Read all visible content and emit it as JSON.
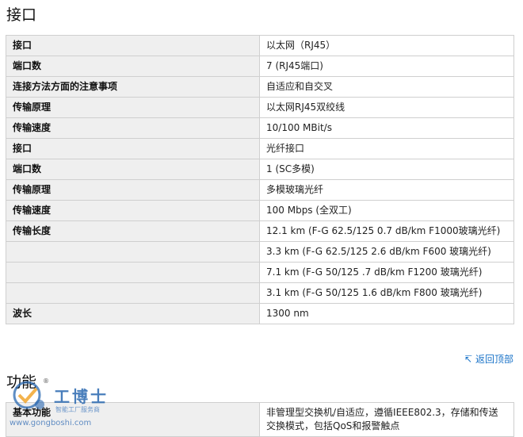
{
  "section1": {
    "title": "接口",
    "rows": [
      {
        "key": "接口",
        "value": "以太网（RJ45）"
      },
      {
        "key": "端口数",
        "value": "7 (RJ45端口)"
      },
      {
        "key": "连接方法方面的注意事项",
        "value": "自适应和自交叉"
      },
      {
        "key": "传输原理",
        "value": "以太网RJ45双绞线"
      },
      {
        "key": "传输速度",
        "value": "10/100 MBit/s"
      },
      {
        "key": "接口",
        "value": "光纤接口"
      },
      {
        "key": "端口数",
        "value": "1 (SC多模)"
      },
      {
        "key": "传输原理",
        "value": "多模玻璃光纤"
      },
      {
        "key": "传输速度",
        "value": "100 Mbps (全双工)"
      },
      {
        "key": "传输长度",
        "value": "12.1 km (F-G 62.5/125 0.7 dB/km F1000玻璃光纤)"
      },
      {
        "key": "",
        "value": "3.3 km (F-G 62.5/125 2.6 dB/km F600 玻璃光纤)"
      },
      {
        "key": "",
        "value": "7.1 km (F-G 50/125 .7 dB/km F1200 玻璃光纤)"
      },
      {
        "key": "",
        "value": "3.1 km (F-G 50/125 1.6 dB/km F800 玻璃光纤)"
      },
      {
        "key": "波长",
        "value": "1300 nm"
      }
    ]
  },
  "back_to_top": "返回顶部",
  "section2": {
    "title": "功能",
    "rows": [
      {
        "key": "基本功能",
        "value": "非管理型交换机/自适应，遵循IEEE802.3，存储和传送交换模式，包括QoS和报警触点"
      }
    ]
  },
  "watermark": {
    "name": "工博士",
    "tagline": "智能工厂服务商",
    "url": "www.gongboshi.com",
    "registered": "®",
    "icon": "gongboshi-logo-icon",
    "color": "#2a68b0"
  }
}
